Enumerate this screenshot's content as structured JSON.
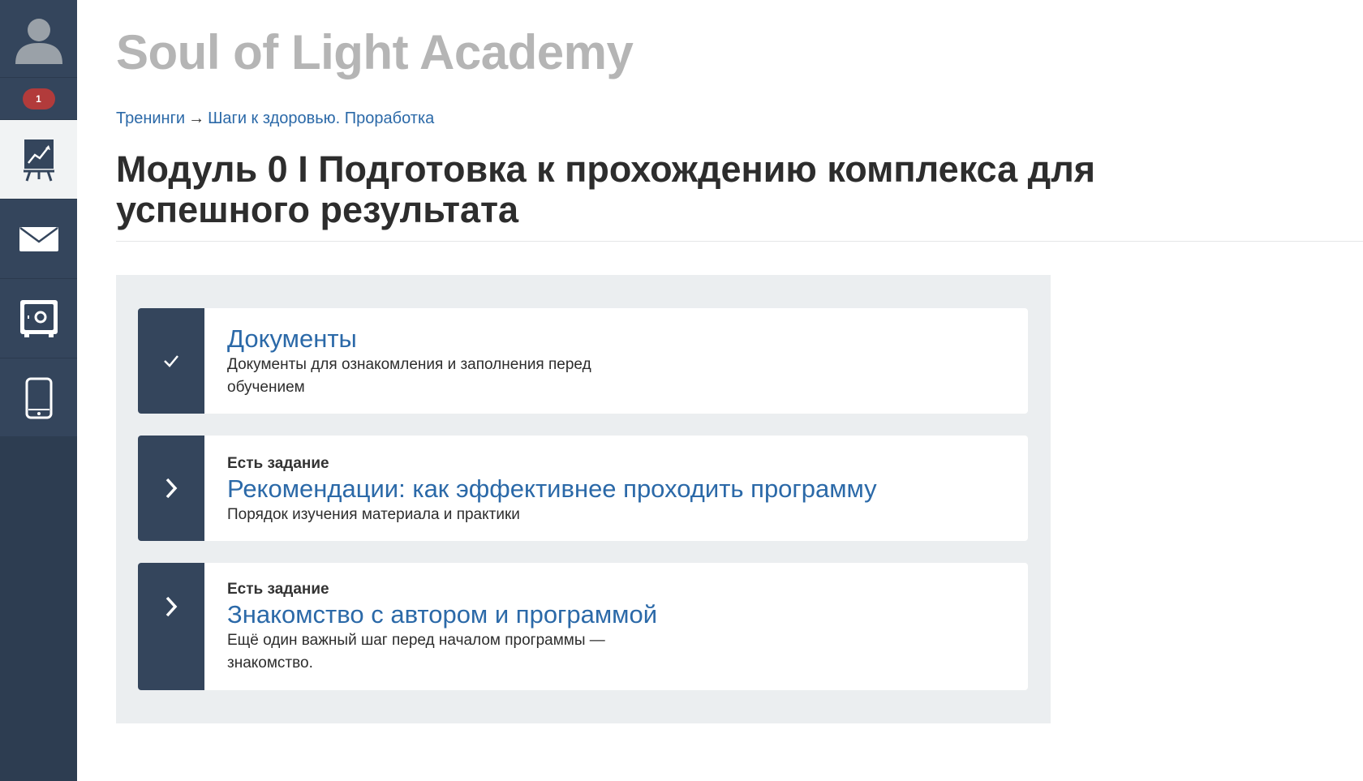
{
  "sidebar": {
    "notification_count": "1",
    "items": [
      {
        "icon": "trainings-chart-icon",
        "active": true
      },
      {
        "icon": "mail-icon",
        "active": false
      },
      {
        "icon": "safe-icon",
        "active": false
      },
      {
        "icon": "mobile-icon",
        "active": false
      }
    ]
  },
  "header": {
    "brand": "Soul of Light Academy"
  },
  "breadcrumb": {
    "root": "Тренинги",
    "arrow": "→",
    "current": "Шаги к здоровью. Проработка"
  },
  "page_title": "Модуль 0 I Подготовка к прохождению комплекса для успешного результата",
  "lessons": [
    {
      "status_icon": "check-icon",
      "task_label": "",
      "title": "Документы",
      "description": "Документы для ознакомления и заполнения перед обучением"
    },
    {
      "status_icon": "chevron-right-icon",
      "task_label": "Есть задание",
      "title": "Рекомендации: как эффективнее проходить программу",
      "description": "Порядок изучения материала и практики"
    },
    {
      "status_icon": "chevron-right-icon",
      "task_label": "Есть задание",
      "title": "Знакомство с автором и программой",
      "description": "Ещё один важный шаг перед началом программы — знакомство."
    }
  ],
  "colors": {
    "sidebar": "#34455c",
    "link": "#2b69a8",
    "badge": "#b23b3b",
    "panel": "#ebeef0"
  }
}
